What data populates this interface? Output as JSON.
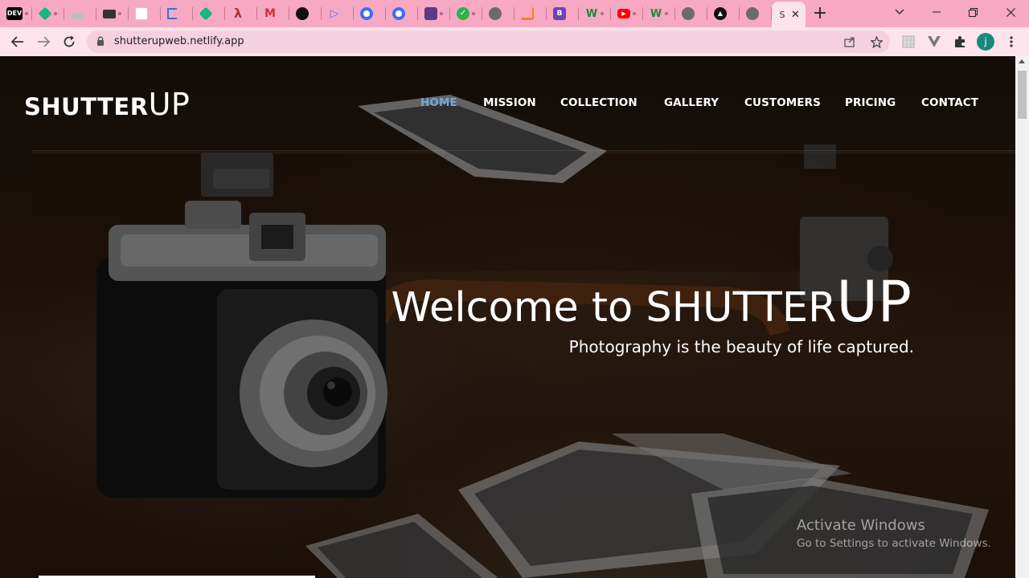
{
  "browser": {
    "tabs": [
      {
        "icon": "dev-icon",
        "label": "DEV",
        "color": "#000000"
      },
      {
        "icon": "diamond-icon",
        "label": "",
        "color": "#18b87b"
      },
      {
        "icon": "shoe-icon",
        "label": "",
        "color": "#9b9b9b"
      },
      {
        "icon": "camera-tab-icon",
        "label": "",
        "color": "#333333"
      },
      {
        "icon": "document-icon",
        "label": "",
        "color": "#ffffff"
      },
      {
        "icon": "flag-icon",
        "label": "",
        "color": "#3b6fd8"
      },
      {
        "icon": "diamond-icon",
        "label": "",
        "color": "#18b87b"
      },
      {
        "icon": "figure-icon",
        "label": "",
        "color": "#b0312c"
      },
      {
        "icon": "gmail-icon",
        "label": "M",
        "color": "#d93025"
      },
      {
        "icon": "github-icon",
        "label": "",
        "color": "#111111"
      },
      {
        "icon": "play-icon",
        "label": "",
        "color": "#5b6cf0"
      },
      {
        "icon": "badge-icon",
        "label": "",
        "color": "#3d6ef6"
      },
      {
        "icon": "badge-icon",
        "label": "",
        "color": "#3d6ef6"
      },
      {
        "icon": "image-icon",
        "label": "",
        "color": "#5a3a8a"
      },
      {
        "icon": "check-icon",
        "label": "",
        "color": "#2db34a"
      },
      {
        "icon": "globe-icon",
        "label": "",
        "color": "#6b6b6b"
      },
      {
        "icon": "stack-icon",
        "label": "",
        "color": "#f48024"
      },
      {
        "icon": "b-icon",
        "label": "B",
        "color": "#6c43b6"
      },
      {
        "icon": "w-icon",
        "label": "W",
        "color": "#1c8a3e"
      },
      {
        "icon": "youtube-icon",
        "label": "",
        "color": "#ff0000"
      },
      {
        "icon": "w-icon",
        "label": "W",
        "color": "#1c8a3e"
      },
      {
        "icon": "globe-icon",
        "label": "",
        "color": "#6b6b6b"
      },
      {
        "icon": "triangle-icon",
        "label": "",
        "color": "#111111"
      },
      {
        "icon": "globe-icon",
        "label": "",
        "color": "#6b6b6b"
      }
    ],
    "active_tab": {
      "label": "S"
    },
    "url": "shutterupweb.netlify.app",
    "profile_initial": "j"
  },
  "site": {
    "logo_part1": "SHUTTER",
    "logo_part2": "UP",
    "nav": [
      "HOME",
      "MISSION",
      "COLLECTION",
      "GALLERY",
      "CUSTOMERS",
      "PRICING",
      "CONTACT"
    ],
    "active_nav": "HOME",
    "hero_title_part1": "Welcome to ",
    "hero_title_part2": "SHUTTER",
    "hero_title_part3": "UP",
    "hero_subtitle": "Photography is the beauty of life captured."
  },
  "watermark": {
    "line1": "Activate Windows",
    "line2": "Go to Settings to activate Windows."
  },
  "colors": {
    "tabstrip": "#f7a8c2",
    "toolbar": "#fde3ec",
    "active_nav": "#6ea9dc"
  }
}
